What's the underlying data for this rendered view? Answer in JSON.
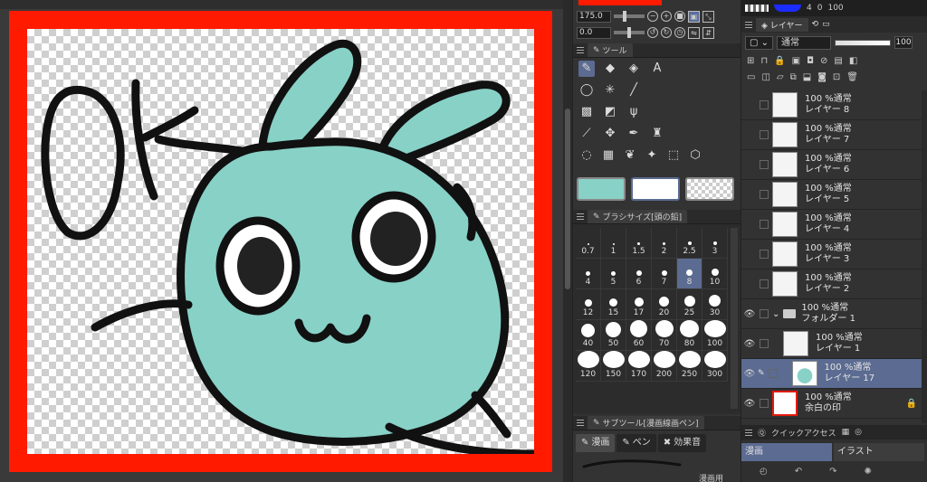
{
  "navigator": {
    "zoom": "175.0",
    "rotation": "0.0"
  },
  "tool_panel": {
    "title": "ツール",
    "rows": [
      [
        "pen-icon",
        "eraser-icon",
        "fill-icon",
        "text-icon"
      ],
      [
        "lasso-icon",
        "magic-wand-icon",
        "line-icon"
      ],
      [
        "pattern-icon",
        "frame-icon",
        "grass-icon"
      ],
      [
        "eyedropper-icon",
        "move-icon",
        "pen-tip-icon",
        "stamp-icon"
      ],
      [
        "bubble-icon",
        "gradient-icon",
        "blend-icon",
        "sparkle-icon",
        "select-icon",
        "3d-icon"
      ]
    ],
    "main_color": "#88d1c7",
    "sub_color": "#ffffff"
  },
  "brush_size": {
    "title": "ブラシサイズ[頭の鉛]",
    "sizes": [
      "0.7",
      "1",
      "1.5",
      "2",
      "2.5",
      "3",
      "4",
      "5",
      "6",
      "7",
      "8",
      "10",
      "12",
      "15",
      "17",
      "20",
      "25",
      "30",
      "40",
      "50",
      "60",
      "70",
      "80",
      "100",
      "120",
      "150",
      "170",
      "200",
      "250",
      "300"
    ],
    "selected": "8"
  },
  "sub_tool": {
    "title": "サブツール[漫画線画ペン]",
    "tabs": [
      "漫画",
      "ペン",
      "効果音"
    ],
    "item_label": "漫画用"
  },
  "layers": {
    "tab_label": "レイヤー",
    "blend_mode": "通常",
    "opacity": "100",
    "top_counts": [
      "4",
      "0",
      "100"
    ],
    "items": [
      {
        "mode": "100 %通常",
        "name": "レイヤー 8",
        "type": "layer"
      },
      {
        "mode": "100 %通常",
        "name": "レイヤー 7",
        "type": "layer"
      },
      {
        "mode": "100 %通常",
        "name": "レイヤー 6",
        "type": "layer"
      },
      {
        "mode": "100 %通常",
        "name": "レイヤー 5",
        "type": "layer"
      },
      {
        "mode": "100 %通常",
        "name": "レイヤー 4",
        "type": "layer"
      },
      {
        "mode": "100 %通常",
        "name": "レイヤー 3",
        "type": "layer"
      },
      {
        "mode": "100 %通常",
        "name": "レイヤー 2",
        "type": "layer"
      },
      {
        "mode": "100 %通常",
        "name": "フォルダー 1",
        "type": "folder"
      },
      {
        "mode": "100 %通常",
        "name": "レイヤー 1",
        "type": "sublayer"
      },
      {
        "mode": "100 %通常",
        "name": "レイヤー 17",
        "type": "sublayer-selected"
      },
      {
        "mode": "100 %通常",
        "name": "余白の印",
        "type": "margin"
      }
    ]
  },
  "quick_access": {
    "title": "クイックアクセス",
    "buttons": [
      "漫画",
      "イラスト"
    ]
  },
  "canvas": {
    "text": "OK",
    "frame_color": "#ff1a00",
    "bunny_fill": "#88d1c7"
  }
}
